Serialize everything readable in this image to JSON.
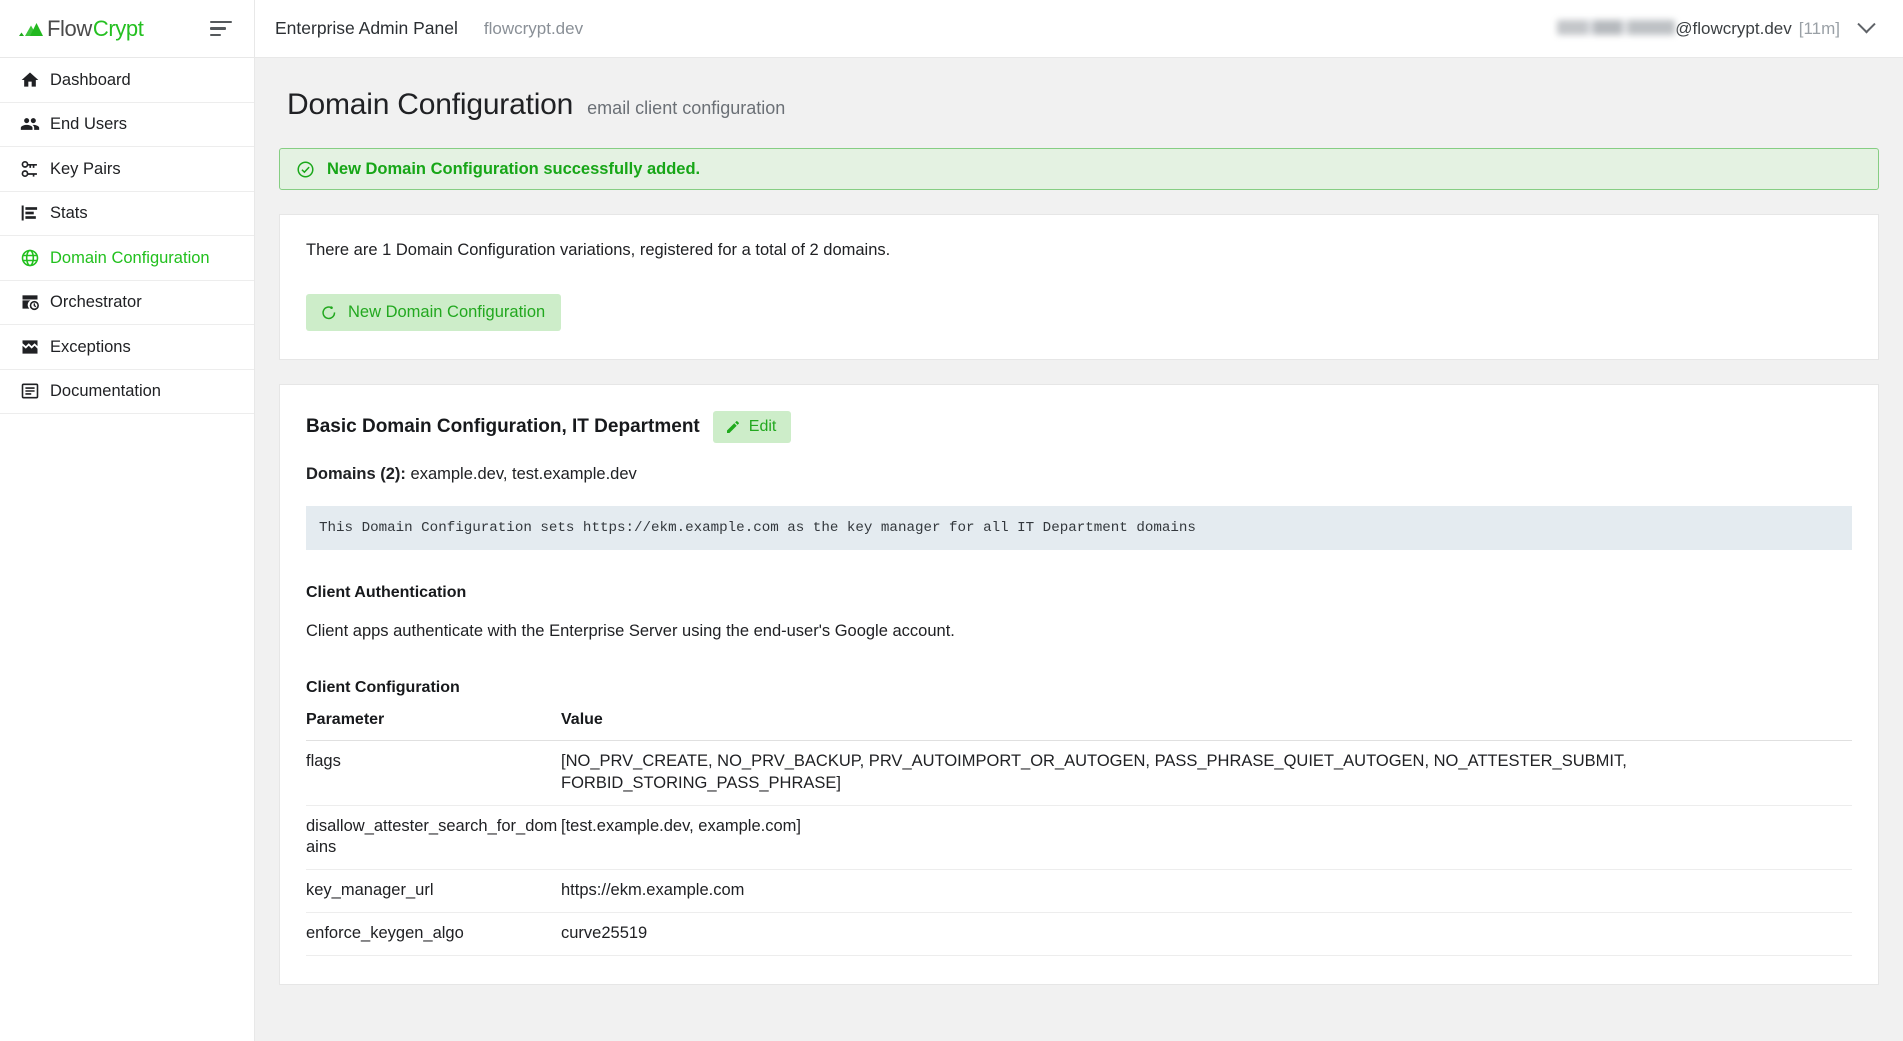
{
  "brand": {
    "name_part1": "Flow",
    "name_part2": "Crypt",
    "logo_icon": "flowcrypt-mountain-logo",
    "menu_icon": "hamburger-menu-icon"
  },
  "topbar": {
    "title": "Enterprise Admin Panel",
    "subtitle": "flowcrypt.dev",
    "account": {
      "username_redacted": true,
      "domain": "@flowcrypt.dev",
      "session": "[11m]",
      "chevron_icon": "chevron-down-icon"
    }
  },
  "sidebar": {
    "items": [
      {
        "label": "Dashboard",
        "icon": "home-icon",
        "active": false
      },
      {
        "label": "End Users",
        "icon": "people-icon",
        "active": false
      },
      {
        "label": "Key Pairs",
        "icon": "key-icon",
        "active": false
      },
      {
        "label": "Stats",
        "icon": "bar-chart-icon",
        "active": false
      },
      {
        "label": "Domain Configuration",
        "icon": "globe-icon",
        "active": true
      },
      {
        "label": "Orchestrator",
        "icon": "schedule-icon",
        "active": false
      },
      {
        "label": "Exceptions",
        "icon": "broken-image-icon",
        "active": false
      },
      {
        "label": "Documentation",
        "icon": "article-icon",
        "active": false
      }
    ]
  },
  "page": {
    "title": "Domain Configuration",
    "subtitle": "email client configuration"
  },
  "alert": {
    "icon": "check-circle-icon",
    "text": "New Domain Configuration successfully added.",
    "bg_color": "#e4f2e2",
    "border_color": "#86ce83",
    "text_color": "#17a617"
  },
  "summary_card": {
    "info": "There are 1 Domain Configuration variations, registered for a total of 2 domains.",
    "new_button": {
      "label": "New Domain Configuration",
      "icon": "refresh-plus-icon",
      "bg_color": "#cdedc9",
      "text_color": "#22a81f"
    }
  },
  "config_card": {
    "title": "Basic Domain Configuration, IT Department",
    "edit_button": {
      "label": "Edit",
      "icon": "pencil-icon"
    },
    "domains_label": "Domains (2):",
    "domains_value": "example.dev, test.example.dev",
    "code_note": "This Domain Configuration sets https://ekm.example.com as the key manager for all IT Department domains",
    "client_auth": {
      "heading": "Client Authentication",
      "body": "Client apps authenticate with the Enterprise Server using the end-user's Google account."
    },
    "client_config": {
      "heading": "Client Configuration",
      "columns": [
        "Parameter",
        "Value"
      ],
      "rows": [
        {
          "parameter": "flags",
          "value": "[NO_PRV_CREATE, NO_PRV_BACKUP, PRV_AUTOIMPORT_OR_AUTOGEN, PASS_PHRASE_QUIET_AUTOGEN, NO_ATTESTER_SUBMIT, FORBID_STORING_PASS_PHRASE]"
        },
        {
          "parameter": "disallow_attester_search_for_domains",
          "value": "[test.example.dev, example.com]"
        },
        {
          "parameter": "key_manager_url",
          "value": "https://ekm.example.com"
        },
        {
          "parameter": "enforce_keygen_algo",
          "value": "curve25519"
        }
      ]
    }
  }
}
